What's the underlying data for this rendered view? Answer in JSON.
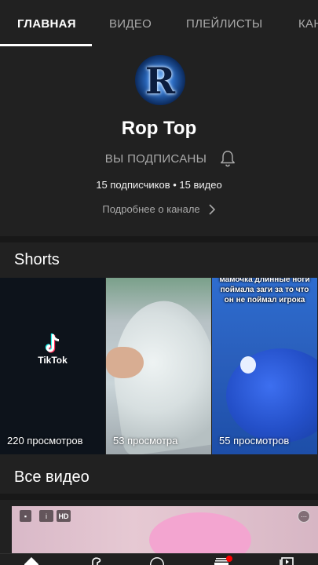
{
  "tabs": [
    {
      "label": "ГЛАВНАЯ",
      "active": true
    },
    {
      "label": "ВИДЕО",
      "active": false
    },
    {
      "label": "ПЛЕЙЛИСТЫ",
      "active": false
    },
    {
      "label": "КАНАЛЫ",
      "active": false
    }
  ],
  "channel": {
    "avatar_letter": "R",
    "name": "Rop Top",
    "subscribed_label": "ВЫ ПОДПИСАНЫ",
    "stats": "15 подписчиков • 15 видео",
    "about_label": "Подробнее о канале"
  },
  "shorts": {
    "title": "Shorts",
    "items": [
      {
        "views": "220 просмотров",
        "logo_text": "TikTok"
      },
      {
        "views": "53 просмотра"
      },
      {
        "views": "55 просмотров",
        "overlay_text": "мамочка длинные ноги поймала заги за то что он не поймал игрока"
      }
    ]
  },
  "videos": {
    "title": "Все видео",
    "badges": {
      "quality": "HD"
    }
  },
  "icons": {
    "bell": "bell-icon",
    "chevron": "chevron-right-icon",
    "home": "home-icon",
    "shorts": "shorts-icon",
    "add": "add-icon",
    "subscriptions": "subscriptions-icon",
    "library": "library-icon"
  },
  "colors": {
    "background": "#212121",
    "text_primary": "#ffffff",
    "text_secondary": "#aaaaaa",
    "notification": "#ff0000"
  }
}
